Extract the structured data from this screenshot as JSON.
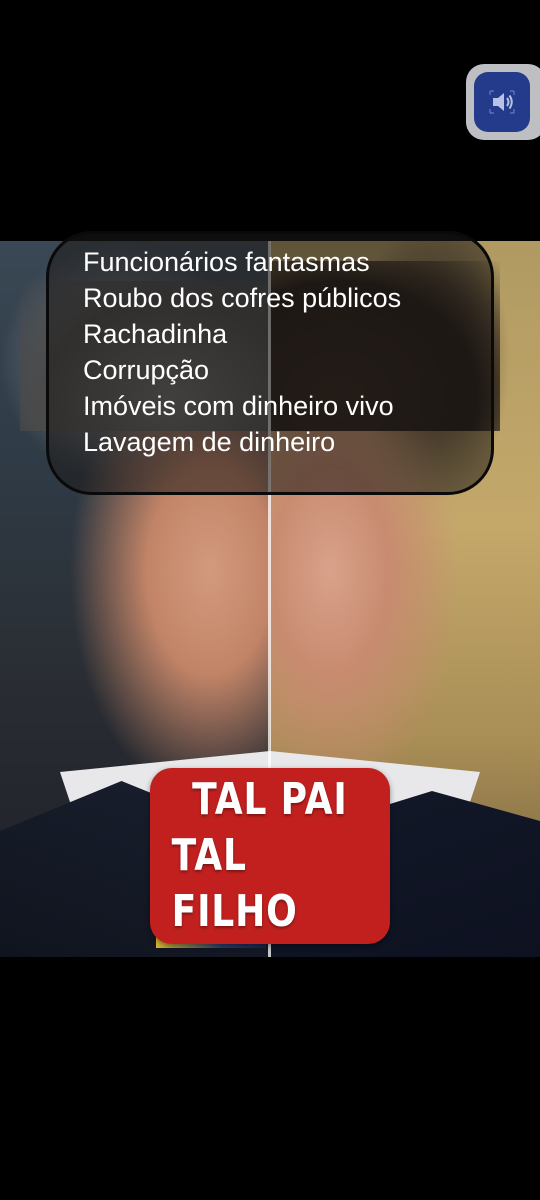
{
  "media": {
    "charges_lines": [
      "Funcionários fantasmas",
      "Roubo dos cofres públicos",
      "Rachadinha",
      "Corrupção",
      "Imóveis com dinheiro vivo",
      "Lavagem de dinheiro"
    ],
    "badge_lines": [
      "TAL PAI",
      "TAL FILHO"
    ]
  },
  "controls": {
    "volume_icon": "speaker-icon"
  },
  "colors": {
    "background": "#000000",
    "badge": "#c1201f",
    "volume_button": "#243a8a"
  }
}
